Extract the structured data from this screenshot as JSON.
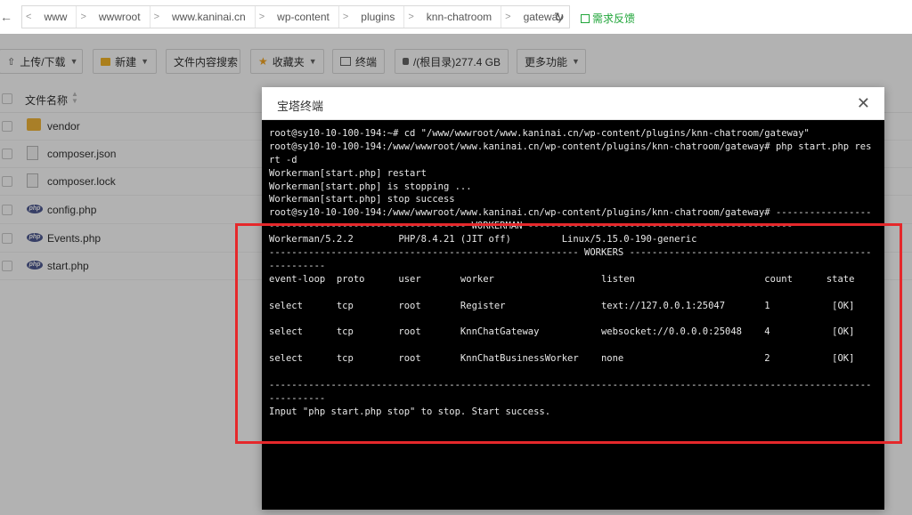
{
  "breadcrumb": {
    "back_icon": "back-arrow-icon",
    "items": [
      "www",
      "wwwroot",
      "www.kaninai.cn",
      "wp-content",
      "plugins",
      "knn-chatroom",
      "gateway"
    ],
    "separator": ">",
    "feedback": "需求反馈"
  },
  "toolbar": {
    "upload": "上传/下载",
    "new": "新建",
    "search": "文件内容搜索",
    "favorites": "收藏夹",
    "terminal": "终端",
    "disk": "/(根目录)277.4 GB",
    "more": "更多功能"
  },
  "file_list": {
    "header": "文件名称",
    "files": [
      {
        "name": "vendor",
        "type": "folder"
      },
      {
        "name": "composer.json",
        "type": "file"
      },
      {
        "name": "composer.lock",
        "type": "file"
      },
      {
        "name": "config.php",
        "type": "php"
      },
      {
        "name": "Events.php",
        "type": "php"
      },
      {
        "name": "start.php",
        "type": "php"
      }
    ]
  },
  "modal": {
    "title": "宝塔终端",
    "close_icon": "close-icon"
  },
  "terminal": {
    "lines": [
      "root@sy10-10-100-194:~# cd \"/www/wwwroot/www.kaninai.cn/wp-content/plugins/knn-chatroom/gateway\"",
      "root@sy10-10-100-194:/www/wwwroot/www.kaninai.cn/wp-content/plugins/knn-chatroom/gateway# php start.php resta",
      "rt -d",
      "Workerman[start.php] restart",
      "Workerman[start.php] is stopping ...",
      "Workerman[start.php] stop success",
      "root@sy10-10-100-194:/www/wwwroot/www.kaninai.cn/wp-content/plugins/knn-chatroom/gateway# -------------------",
      "----------------------------------- WORKERMAN -----------------------------------------------",
      "Workerman/5.2.2        PHP/8.4.21 (JIT off)         Linux/5.15.0-190-generic",
      "------------------------------------------------------- WORKERS ----------------------------------------------",
      "----------",
      "event-loop  proto      user       worker                   listen                       count      state",
      "",
      "select      tcp        root       Register                 text://127.0.0.1:25047       1           [OK]",
      "",
      "select      tcp        root       KnnChatGateway           websocket://0.0.0.0:25048    4           [OK]",
      "",
      "select      tcp        root       KnnChatBusinessWorker    none                         2           [OK]",
      "",
      "--------------------------------------------------------------------------------------------------------------",
      "----------",
      "Input \"php start.php stop\" to stop. Start success."
    ]
  },
  "colors": {
    "accent": "#20a53a",
    "highlight_border": "#e5282b",
    "terminal_bg": "#000000",
    "terminal_fg": "#e8e8e8"
  }
}
